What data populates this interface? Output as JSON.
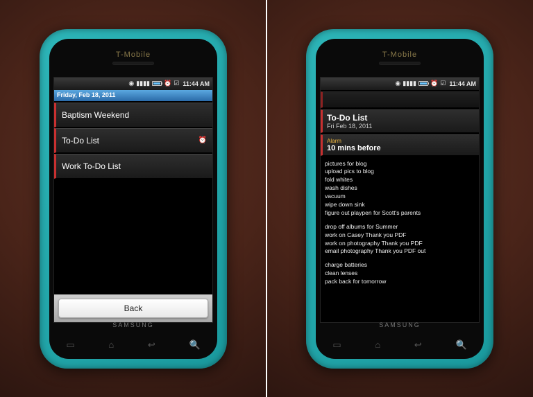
{
  "carrier": "T-Mobile",
  "brand": "SAMSUNG",
  "status": {
    "time": "11:44 AM"
  },
  "left": {
    "date_header": "Friday, Feb 18, 2011",
    "rows": [
      {
        "title": "Baptism Weekend",
        "alarm": false
      },
      {
        "title": "To-Do List",
        "alarm": true
      },
      {
        "title": "Work To-Do List",
        "alarm": false
      }
    ],
    "back": "Back"
  },
  "right": {
    "title": "To-Do List",
    "subtitle": "Fri Feb 18, 2011",
    "alarm_label": "Alarm",
    "alarm_value": "10 mins before",
    "notes_g1": [
      "pictures for blog",
      "upload pics to blog",
      "fold whites",
      "wash dishes",
      "vacuum",
      "wipe down sink",
      "figure out playpen for Scott's parents"
    ],
    "notes_g2": [
      "drop off albums for Summer",
      "work on Casey Thank you PDF",
      "work on photography Thank you PDF",
      "email photography Thank you PDF out"
    ],
    "notes_g3": [
      "charge batteries",
      "clean lenses",
      "pack back for tomorrow"
    ]
  }
}
